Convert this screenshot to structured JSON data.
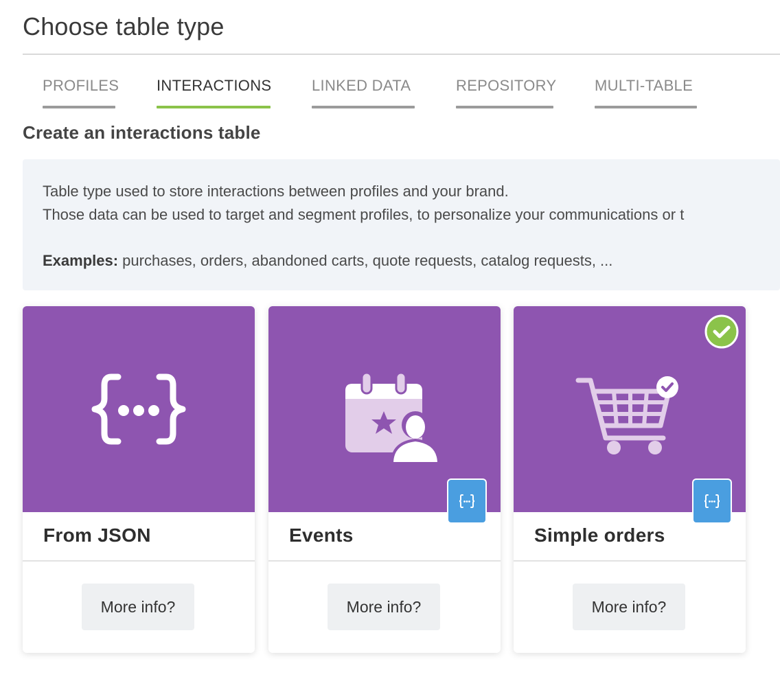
{
  "page_title": "Choose table type",
  "tabs": [
    {
      "label": "PROFILES",
      "active": false
    },
    {
      "label": "INTERACTIONS",
      "active": true
    },
    {
      "label": "LINKED DATA",
      "active": false
    },
    {
      "label": "REPOSITORY",
      "active": false
    },
    {
      "label": "MULTI-TABLE",
      "active": false
    }
  ],
  "section_title": "Create an interactions table",
  "info": {
    "line1": "Table type used to store interactions between profiles and your brand.",
    "line2": "Those data can be used to target and segment profiles, to personalize your communications or t",
    "examples_label": "Examples:",
    "examples_text": " purchases, orders, abandoned carts, quote requests, catalog requests, ..."
  },
  "cards": [
    {
      "label": "From JSON",
      "button": "More info?",
      "icon": "json-braces-icon",
      "has_json_badge": false,
      "selected": false
    },
    {
      "label": "Events",
      "button": "More info?",
      "icon": "calendar-user-icon",
      "has_json_badge": true,
      "selected": false
    },
    {
      "label": "Simple orders",
      "button": "More info?",
      "icon": "shopping-cart-check-icon",
      "has_json_badge": true,
      "selected": true
    }
  ],
  "colors": {
    "card_top": "#8e55b0",
    "active_tab": "#8bc34a",
    "badge": "#4a9ee0",
    "check": "#8bc34a"
  }
}
